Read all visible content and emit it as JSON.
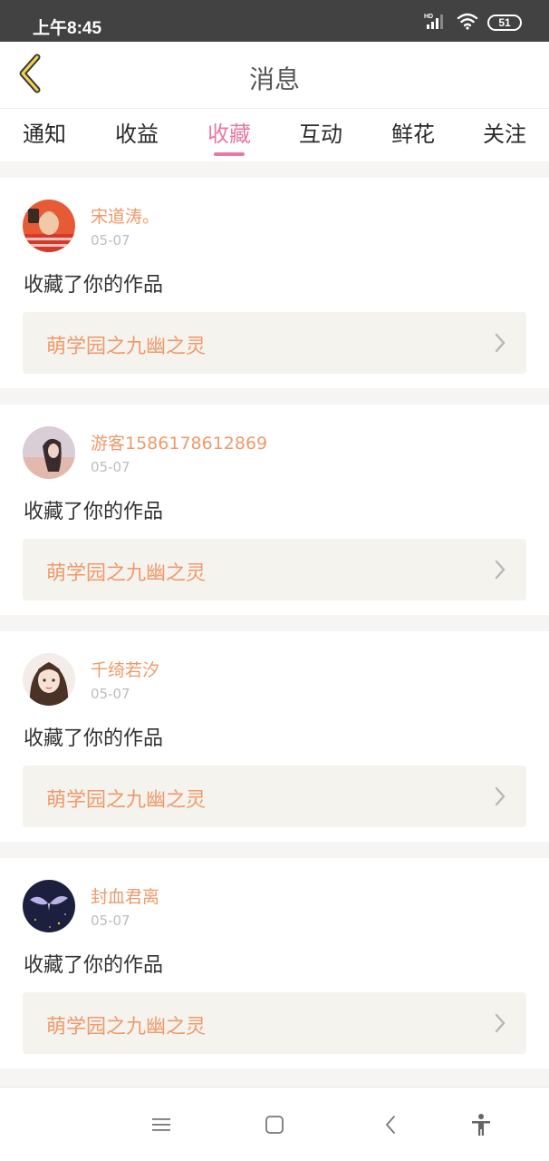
{
  "status_bar": {
    "time": "上午8:45",
    "battery": "51",
    "icons": [
      "hd-signal-icon",
      "wifi-icon",
      "battery-icon"
    ]
  },
  "header": {
    "back_icon": "back-chevron-icon",
    "title": "消息"
  },
  "tabs": [
    {
      "label": "通知"
    },
    {
      "label": "收益"
    },
    {
      "label": "收藏"
    },
    {
      "label": "互动"
    },
    {
      "label": "鲜花"
    },
    {
      "label": "关注"
    }
  ],
  "active_tab": "收藏",
  "colors": {
    "accent_pink": "#e779a6",
    "username_orange": "#ef9a6b",
    "link_background": "#f4f3ee"
  },
  "messages": [
    {
      "username": "宋道涛。",
      "date": "05-07",
      "action": "收藏了你的作品",
      "work_title": "萌学园之九幽之灵"
    },
    {
      "username": "游客1586178612869",
      "date": "05-07",
      "action": "收藏了你的作品",
      "work_title": "萌学园之九幽之灵"
    },
    {
      "username": "千绮若汐",
      "date": "05-07",
      "action": "收藏了你的作品",
      "work_title": "萌学园之九幽之灵"
    },
    {
      "username": "封血君离",
      "date": "05-07",
      "action": "收藏了你的作品",
      "work_title": "萌学园之九幽之灵"
    }
  ],
  "nav_bar": {
    "buttons": [
      "menu-icon",
      "home-icon",
      "back-icon",
      "accessibility-icon"
    ]
  }
}
